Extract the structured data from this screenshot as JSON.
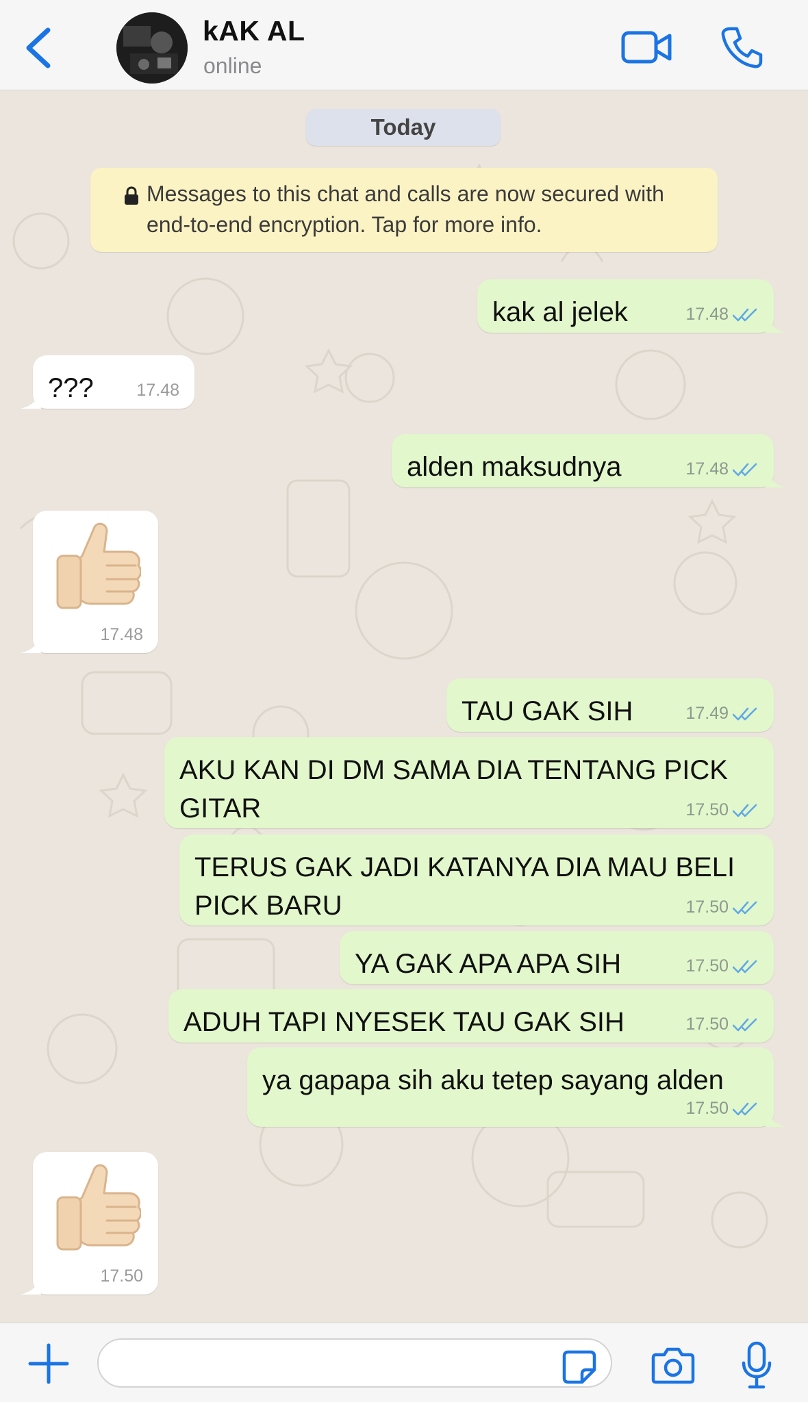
{
  "header": {
    "back_icon": "chevron-left-icon",
    "contact_name": "kAK AL",
    "status": "online",
    "video_icon": "video-camera-icon",
    "call_icon": "phone-icon"
  },
  "chat": {
    "date_chip": "Today",
    "encryption_notice": "Messages to this chat and calls are now secured with end-to-end encryption. Tap for more info.",
    "messages": [
      {
        "dir": "out",
        "text": "kak al jelek",
        "time": "17.48",
        "status": "sent"
      },
      {
        "dir": "in",
        "text": "???",
        "time": "17.48"
      },
      {
        "dir": "out",
        "text": "alden maksudnya",
        "time": "17.48",
        "status": "sent"
      },
      {
        "dir": "in",
        "emoji": "thumbs-up",
        "time": "17.48"
      },
      {
        "dir": "out",
        "text": "TAU GAK SIH",
        "time": "17.49",
        "status": "sent"
      },
      {
        "dir": "out",
        "text": "AKU KAN DI DM SAMA DIA TENTANG PICK GITAR",
        "time": "17.50",
        "status": "sent"
      },
      {
        "dir": "out",
        "text": "TERUS GAK JADI KATANYA DIA MAU BELI PICK BARU",
        "time": "17.50",
        "status": "sent"
      },
      {
        "dir": "out",
        "text": "YA GAK APA APA SIH",
        "time": "17.50",
        "status": "sent"
      },
      {
        "dir": "out",
        "text": "ADUH TAPI NYESEK TAU GAK SIH",
        "time": "17.50",
        "status": "sent"
      },
      {
        "dir": "out",
        "text": "ya gapapa sih aku tetep sayang alden",
        "time": "17.50",
        "status": "sent"
      },
      {
        "dir": "in",
        "emoji": "thumbs-up",
        "time": "17.50"
      }
    ]
  },
  "input_bar": {
    "placeholder": "",
    "attach_icon": "plus-icon",
    "sticker_icon": "sticker-icon",
    "camera_icon": "camera-icon",
    "mic_icon": "microphone-icon"
  },
  "colors": {
    "accent": "#1b74e4",
    "outgoing_bubble": "#e2f7cb",
    "incoming_bubble": "#ffffff",
    "chat_background": "#ebe5dd",
    "encryption_notice_bg": "#fcf3c4",
    "read_ticks": "#5fa8e8"
  }
}
